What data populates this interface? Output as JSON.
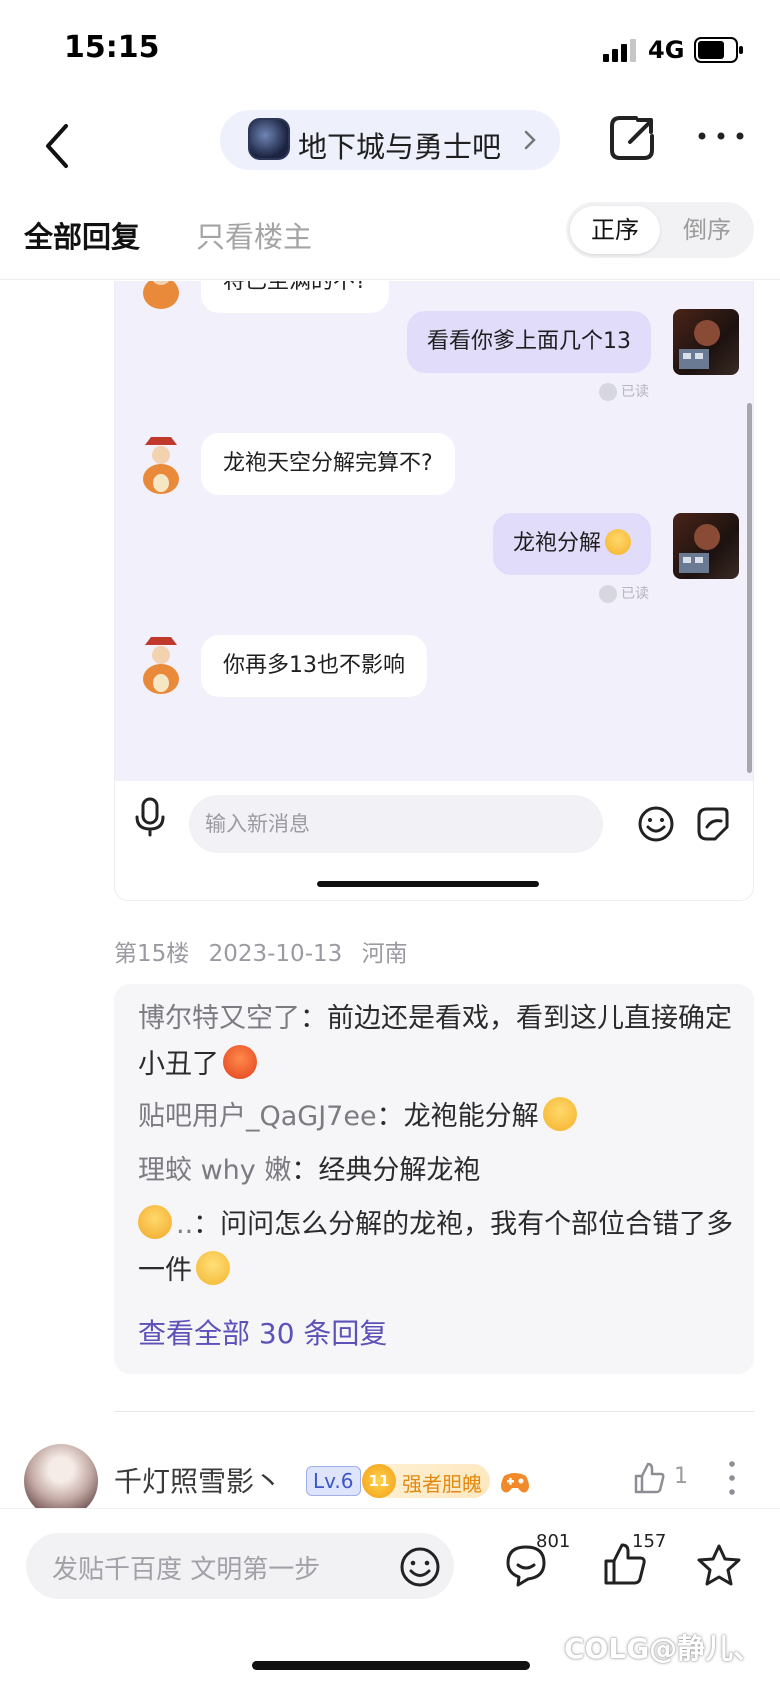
{
  "status": {
    "time": "15:15",
    "network": "4G"
  },
  "nav": {
    "forum_name": "地下城与勇士吧"
  },
  "tabs": {
    "all_replies": "全部回复",
    "only_op": "只看楼主",
    "order_asc": "正序",
    "order_desc": "倒序"
  },
  "chat": {
    "cut_message": "将已至满的不?",
    "messages": [
      {
        "side": "right",
        "text": "看看你爹上面几个13",
        "read": "已读"
      },
      {
        "side": "left",
        "text": "龙袍天空分解完算不?"
      },
      {
        "side": "right",
        "text": "龙袍分解",
        "read": "已读"
      },
      {
        "side": "left",
        "text": "你再多13也不影响"
      }
    ],
    "input_placeholder": "输入新消息"
  },
  "floor": {
    "label": "第15楼",
    "date": "2023-10-13",
    "location": "河南"
  },
  "replies": [
    {
      "name": "博尔特又空了",
      "text": "前边还是看戏，看到这儿直接确定小丑了"
    },
    {
      "name": "贴吧用户_QaGJ7ee",
      "text": "龙袍能分解"
    },
    {
      "name": "理蛟 why 嫩",
      "text": "经典分解龙袍"
    },
    {
      "name": "..",
      "text": "问问怎么分解的龙袍，我有个部位合错了多一件"
    }
  ],
  "replies_sep": "：",
  "view_all": "查看全部 30 条回复",
  "next_post": {
    "username": "千灯照雪影丶",
    "level": "Lv.6",
    "badge_num": "11",
    "badge_title": "强者胆魄",
    "likes": "1"
  },
  "bottom": {
    "compose_placeholder": "发贴千百度 文明第一步",
    "comments": "801",
    "likes": "157",
    "watermark": "COLG@静儿、"
  },
  "colors": {
    "accent": "#5b51b8",
    "bubble_right": "#e2dcfb",
    "chat_bg": "#f1f0fb"
  }
}
